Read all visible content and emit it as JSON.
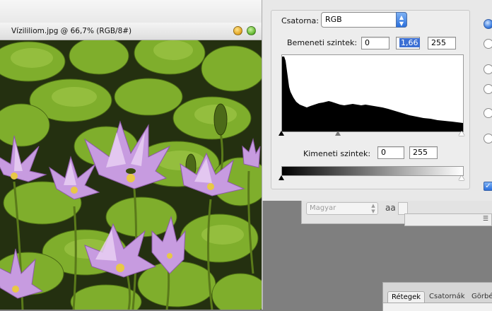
{
  "document": {
    "title": "Vízililiom.jpg @ 66,7% (RGB/8#)"
  },
  "levels": {
    "channel_label": "Csatorna:",
    "channel_value": "RGB",
    "input_label": "Bemeneti szintek:",
    "input_black": "0",
    "input_gamma": "1,66",
    "input_white": "255",
    "output_label": "Kimeneti szintek:",
    "output_black": "0",
    "output_white": "255"
  },
  "character": {
    "font_placeholder": "Magyar",
    "antialias_icon": "aa"
  },
  "layers_panel": {
    "tabs": [
      {
        "label": "Rétegek"
      },
      {
        "label": "Csatornák"
      },
      {
        "label": "Görbé"
      }
    ]
  },
  "colors": {
    "accent": "#2a6fdc",
    "selection": "#3b6fd4"
  }
}
